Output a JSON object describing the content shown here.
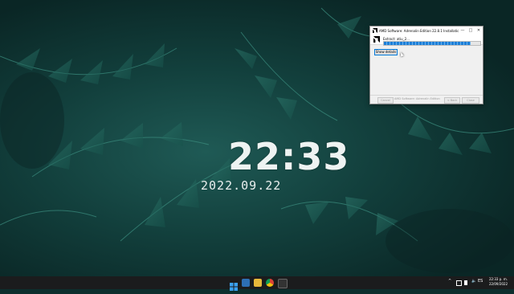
{
  "desktop": {
    "clock": "22:33",
    "date": "2022.09.22"
  },
  "installer": {
    "title": "AMD Software: Adrenalin Edition 22.8.1 Installation",
    "status_text": "Extract: atiu_2...",
    "progress": 0.9,
    "show_details_label": "Show details",
    "footer_brand": "AMD Software: Adrenalin Edition",
    "buttons": {
      "cancel": "Cancel",
      "back": "< Back",
      "close": "Close"
    },
    "titlebar_buttons": {
      "minimize": "—",
      "maximize": "□",
      "close": "✕"
    }
  },
  "taskbar": {
    "time": "22:33 p. m.",
    "date": "22/09/2022",
    "tray": {
      "chevron": "^",
      "language": "ES"
    },
    "apps": [
      "start-icon",
      "widgets-icon",
      "explorer-icon",
      "chrome-icon",
      "store-icon",
      "media-icon"
    ]
  },
  "colors": {
    "accent": "#1d7fd8",
    "taskbar": "#1b1c1d",
    "wallpaper": "#123f3c"
  }
}
